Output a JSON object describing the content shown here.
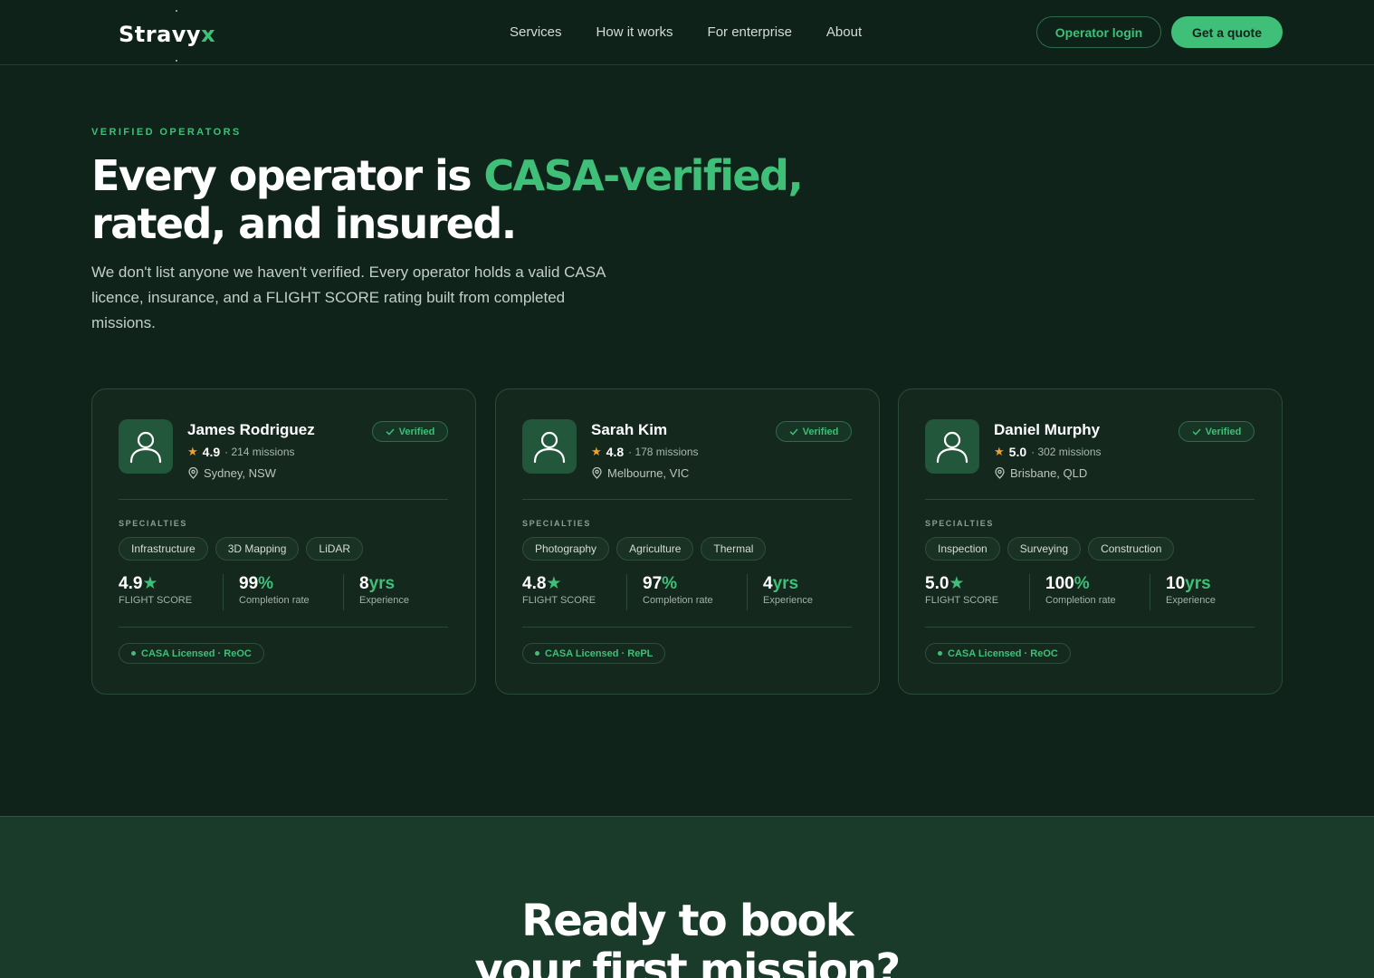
{
  "brand": {
    "name_main": "Stravy",
    "name_accent": "x"
  },
  "nav": {
    "links": [
      "Services",
      "How it works",
      "For enterprise",
      "About"
    ],
    "login_label": "Operator login",
    "quote_label": "Get a quote"
  },
  "hero": {
    "eyebrow": "VERIFIED OPERATORS",
    "headline_part1": "Every operator is ",
    "headline_accent": "CASA-verified,",
    "headline_part2": "rated, and insured.",
    "lede": "We don't list anyone we haven't verified. Every operator holds a valid CASA licence, insurance, and a FLIGHT SCORE rating built from completed missions."
  },
  "operators": [
    {
      "name": "James Rodriguez",
      "rating": "4.9",
      "missions": "· 214 missions",
      "location": "Sydney, NSW",
      "badge": "Verified",
      "specialties_label": "SPECIALTIES",
      "specialties": [
        "Infrastructure",
        "3D Mapping",
        "LiDAR"
      ],
      "flight_score": "4.9",
      "flight_score_label": "FLIGHT SCORE",
      "completion": "99",
      "completion_unit": "%",
      "completion_label": "Completion rate",
      "experience": "8",
      "experience_unit": "yrs",
      "experience_label": "Experience",
      "license": "CASA Licensed · ReOC"
    },
    {
      "name": "Sarah Kim",
      "rating": "4.8",
      "missions": "· 178 missions",
      "location": "Melbourne, VIC",
      "badge": "Verified",
      "specialties_label": "SPECIALTIES",
      "specialties": [
        "Photography",
        "Agriculture",
        "Thermal"
      ],
      "flight_score": "4.8",
      "flight_score_label": "FLIGHT SCORE",
      "completion": "97",
      "completion_unit": "%",
      "completion_label": "Completion rate",
      "experience": "4",
      "experience_unit": "yrs",
      "experience_label": "Experience",
      "license": "CASA Licensed · RePL"
    },
    {
      "name": "Daniel Murphy",
      "rating": "5.0",
      "missions": "· 302 missions",
      "location": "Brisbane, QLD",
      "badge": "Verified",
      "specialties_label": "SPECIALTIES",
      "specialties": [
        "Inspection",
        "Surveying",
        "Construction"
      ],
      "flight_score": "5.0",
      "flight_score_label": "FLIGHT SCORE",
      "completion": "100",
      "completion_unit": "%",
      "completion_label": "Completion rate",
      "experience": "10",
      "experience_unit": "yrs",
      "experience_label": "Experience",
      "license": "CASA Licensed · ReOC"
    }
  ],
  "cta": {
    "line1": "Ready to book",
    "line2": "your first mission?"
  },
  "colors": {
    "accent": "#3fbf78",
    "background": "#10231a",
    "card": "#15281e",
    "star": "#f0a030"
  },
  "icons": [
    "user-icon",
    "star-icon",
    "location-pin-icon",
    "check-icon"
  ]
}
